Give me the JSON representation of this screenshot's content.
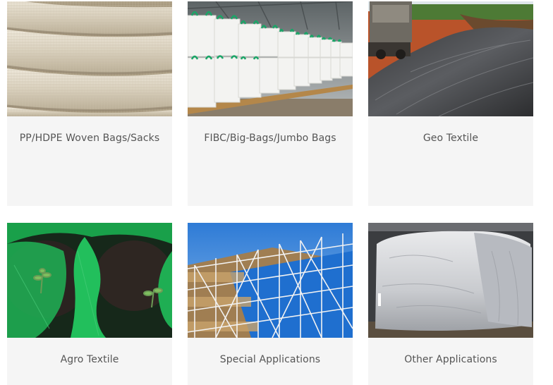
{
  "products": [
    {
      "label": "PP/HDPE Woven Bags/Sacks",
      "image": "stacked-woven-sacks"
    },
    {
      "label": "FIBC/Big-Bags/Jumbo Bags",
      "image": "warehouse-jumbo-bags"
    },
    {
      "label": "Geo Textile",
      "image": "geotextile-site"
    },
    {
      "label": "Agro Textile",
      "image": "green-grow-bags"
    },
    {
      "label": "Special Applications",
      "image": "scaffolding-net"
    },
    {
      "label": "Other Applications",
      "image": "bulk-container-liner"
    }
  ],
  "colors": {
    "card_bg": "#f5f5f5",
    "caption_text": "#555555"
  }
}
